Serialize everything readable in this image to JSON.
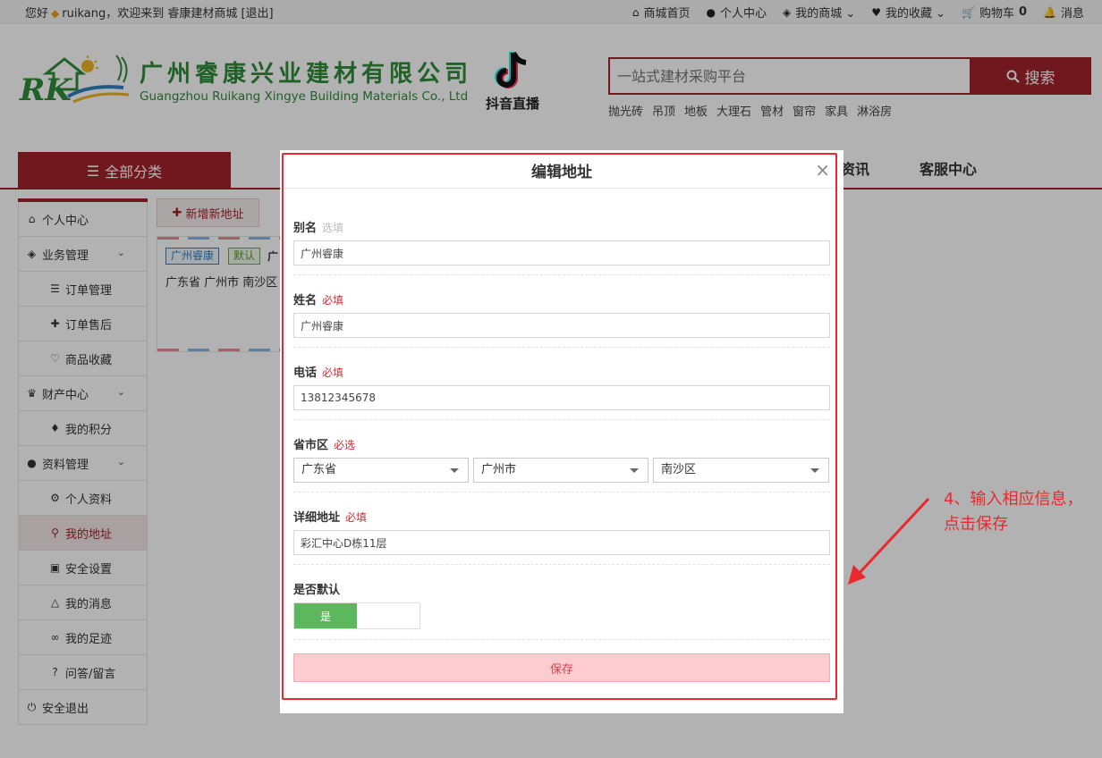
{
  "topbar": {
    "greeting_prefix": "您好",
    "username": "ruikang",
    "welcome": "，欢迎来到 睿康建材商城 [退出]",
    "links": [
      {
        "icon": "home-icon",
        "glyph": "⌂",
        "label": "商城首页"
      },
      {
        "icon": "user-icon",
        "glyph": "●",
        "label": "个人中心"
      },
      {
        "icon": "cube-icon",
        "glyph": "◈",
        "label": "我的商城 ⌄"
      },
      {
        "icon": "heart-icon",
        "glyph": "♥",
        "label": "我的收藏 ⌄"
      },
      {
        "icon": "cart-icon",
        "glyph": "🛒",
        "label": "购物车",
        "count": "0"
      },
      {
        "icon": "bell-icon",
        "glyph": "🔔",
        "label": "消息"
      }
    ]
  },
  "header": {
    "company_cn": "广州睿康兴业建材有限公司",
    "company_en": "Guangzhou Ruikang Xingye Building Materials Co., Ltd",
    "douyin_label": "抖音直播",
    "search_placeholder": "一站式建材采购平台",
    "search_button": "搜索",
    "hot_words": [
      "抛光砖",
      "吊顶",
      "地板",
      "大理石",
      "管材",
      "窗帘",
      "家具",
      "淋浴房"
    ]
  },
  "nav": {
    "all_categories": "全部分类",
    "links": [
      "资讯",
      "客服中心"
    ]
  },
  "sidebar": {
    "items": [
      {
        "label": "个人中心",
        "icon": "home-icon",
        "glyph": "⌂",
        "level": "top"
      },
      {
        "label": "业务管理",
        "icon": "cube-icon",
        "glyph": "◈",
        "level": "top",
        "expand": true
      },
      {
        "label": "订单管理",
        "icon": "list-icon",
        "glyph": "☰",
        "level": "sub"
      },
      {
        "label": "订单售后",
        "icon": "puzzle-icon",
        "glyph": "✚",
        "level": "sub"
      },
      {
        "label": "商品收藏",
        "icon": "heart-outline-icon",
        "glyph": "♡",
        "level": "sub"
      },
      {
        "label": "财产中心",
        "icon": "trophy-icon",
        "glyph": "♛",
        "level": "top",
        "expand": true
      },
      {
        "label": "我的积分",
        "icon": "fire-icon",
        "glyph": "♦",
        "level": "sub"
      },
      {
        "label": "资料管理",
        "icon": "user-icon",
        "glyph": "●",
        "level": "top",
        "expand": true
      },
      {
        "label": "个人资料",
        "icon": "gear-icon",
        "glyph": "⚙",
        "level": "sub"
      },
      {
        "label": "我的地址",
        "icon": "pin-icon",
        "glyph": "⚲",
        "level": "sub",
        "active": true
      },
      {
        "label": "安全设置",
        "icon": "lock-icon",
        "glyph": "▣",
        "level": "sub"
      },
      {
        "label": "我的消息",
        "icon": "bell-outline-icon",
        "glyph": "△",
        "level": "sub"
      },
      {
        "label": "我的足迹",
        "icon": "footprint-icon",
        "glyph": "∞",
        "level": "sub"
      },
      {
        "label": "问答/留言",
        "icon": "question-icon",
        "glyph": "?",
        "level": "sub"
      },
      {
        "label": "安全退出",
        "icon": "power-icon",
        "glyph": "⏻",
        "level": "top"
      }
    ]
  },
  "content": {
    "add_button": "新增新地址",
    "card": {
      "tag_name": "广州睿康",
      "tag_default": "默认",
      "tag_extra": "广",
      "address": "广东省 广州市 南沙区"
    }
  },
  "modal": {
    "title": "编辑地址",
    "close": "×",
    "alias_label": "别名",
    "alias_hint": "选填",
    "alias_value": "广州睿康",
    "name_label": "姓名",
    "name_hint": "必填",
    "name_value": "广州睿康",
    "phone_label": "电话",
    "phone_hint": "必填",
    "phone_value": "13812345678",
    "region_label": "省市区",
    "region_hint": "必选",
    "province": "广东省",
    "city": "广州市",
    "district": "南沙区",
    "detail_label": "详细地址",
    "detail_hint": "必填",
    "detail_value": "彩汇中心D栋11层",
    "default_label": "是否默认",
    "toggle_on": "是",
    "save": "保存"
  },
  "annotation": {
    "text": "4、输入相应信息，点击保存"
  },
  "colors": {
    "brand": "#a3212b",
    "logo_green": "#2e8b3a",
    "annotation_red": "#e8292d",
    "toggle_green": "#5cb85c"
  }
}
